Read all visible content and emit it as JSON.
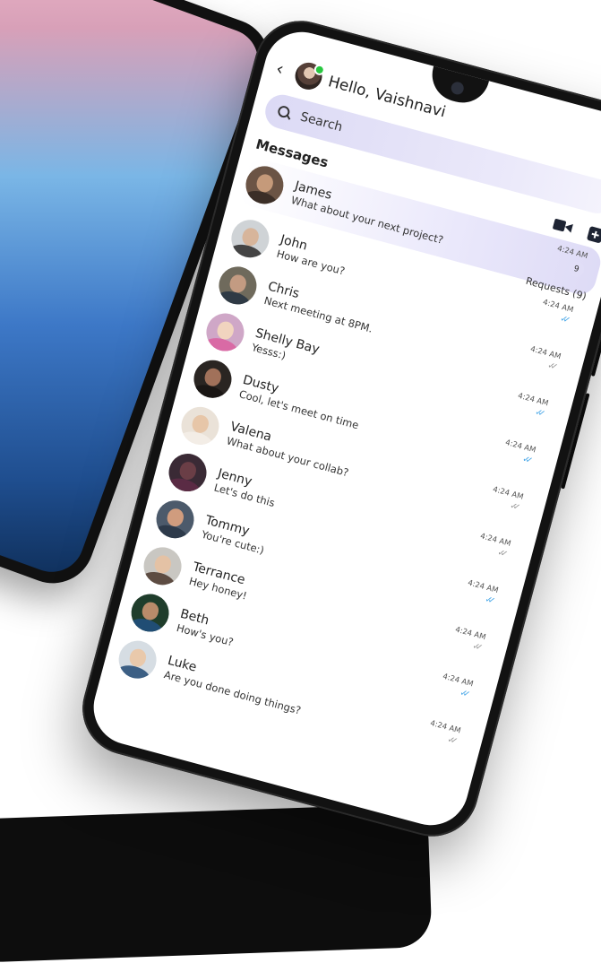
{
  "header": {
    "back_glyph": "‹",
    "greeting": "Hello, Vaishnavi",
    "online_color": "#28c840"
  },
  "search": {
    "placeholder": "Search",
    "icon": "search-icon"
  },
  "messages": {
    "title": "Messages",
    "video_icon": "video-camera-icon",
    "add_icon": "add-square-icon",
    "requests_label": "Requests (9)"
  },
  "colors": {
    "accent_light": "#e1def7",
    "tick_read": "#4aa8e8",
    "tick_sent": "#9a9a9a"
  },
  "conversations": [
    {
      "name": "James",
      "preview": "What about your next project?",
      "time": "4:24 AM",
      "badge": "9",
      "status": ""
    },
    {
      "name": "John",
      "preview": "How are you?",
      "time": "4:24 AM",
      "badge": "",
      "status": "read"
    },
    {
      "name": "Chris",
      "preview": "Next meeting at 8PM.",
      "time": "4:24 AM",
      "badge": "",
      "status": "sent"
    },
    {
      "name": "Shelly Bay",
      "preview": "Yesss:)",
      "time": "4:24 AM",
      "badge": "",
      "status": "read"
    },
    {
      "name": "Dusty",
      "preview": "Cool, let's meet on time",
      "time": "4:24 AM",
      "badge": "",
      "status": "read"
    },
    {
      "name": "Valena",
      "preview": "What about your collab?",
      "time": "4:24 AM",
      "badge": "",
      "status": "sent"
    },
    {
      "name": "Jenny",
      "preview": "Let's do this",
      "time": "4:24 AM",
      "badge": "",
      "status": "sent"
    },
    {
      "name": "Tommy",
      "preview": "You're cute:)",
      "time": "4:24 AM",
      "badge": "",
      "status": "read"
    },
    {
      "name": "Terrance",
      "preview": "Hey honey!",
      "time": "4:24 AM",
      "badge": "",
      "status": "sent"
    },
    {
      "name": "Beth",
      "preview": "How's you?",
      "time": "4:24 AM",
      "badge": "",
      "status": "read"
    },
    {
      "name": "Luke",
      "preview": "Are you done doing things?",
      "time": "4:24 AM",
      "badge": "",
      "status": "sent"
    }
  ]
}
